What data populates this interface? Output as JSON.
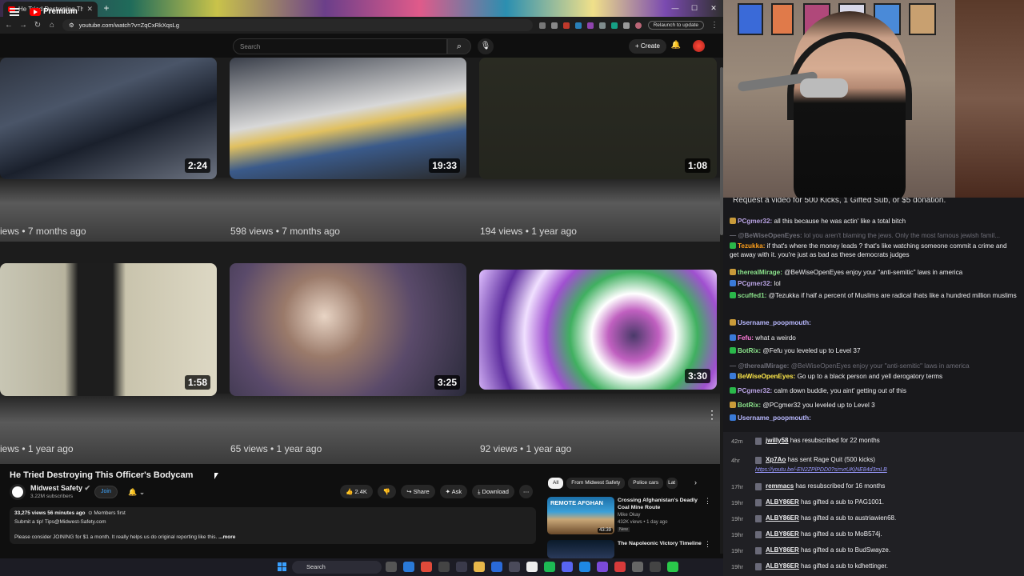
{
  "browser": {
    "tab_title": "He Tried Destroying This Of",
    "url": "youtube.com/watch?v=ZqCxRkXqsLg",
    "relaunch": "Relaunch to update"
  },
  "youtube": {
    "logo": "Premium",
    "search_placeholder": "Search",
    "create": "+ Create"
  },
  "endscreen": {
    "row1": [
      {
        "duration": "2:24",
        "meta": "iews • 7 months ago"
      },
      {
        "duration": "19:33",
        "meta": "598 views • 7 months ago"
      },
      {
        "duration": "1:08",
        "meta": "194 views • 1 year ago"
      }
    ],
    "row2": [
      {
        "duration": "1:58",
        "meta": "iews • 1 year ago"
      },
      {
        "duration": "3:25",
        "meta": "65 views • 1 year ago"
      },
      {
        "duration": "3:30",
        "meta": "92 views • 1 year ago"
      }
    ]
  },
  "video": {
    "title": "He Tried Destroying This Officer's Bodycam",
    "channel": "Midwest Safety",
    "subscribers": "3.22M subscribers",
    "join": "Join",
    "likes": "2.4K",
    "share": "Share",
    "ask": "Ask",
    "download": "Download",
    "desc_line1": "33,275 views  56 minutes ago",
    "desc_members": "Members first",
    "desc_line2": "Submit a tip! Tips@Midwest-Safety.com",
    "desc_line3": "Please consider JOINING for $1 a month. It really helps us do original reporting like this.",
    "desc_more": "...more"
  },
  "sidebar": {
    "chips": [
      "All",
      "From Midwest Safety",
      "Police cars",
      "Lat"
    ],
    "recs": [
      {
        "title": "Crossing Afghanistan's Deadly Coal Mine Route",
        "channel": "Mike Okay",
        "views": "432K views • 1 day ago",
        "badge": "New",
        "duration": "43:39",
        "thumb_text": "REMOTE AFGHAN"
      },
      {
        "title": "The Napoleonic Victory Timeline",
        "channel": "",
        "views": "",
        "badge": "",
        "duration": "",
        "thumb_text": ""
      }
    ]
  },
  "taskbar": {
    "search": "Search"
  },
  "chat": {
    "top": "Request a video for 500 Kicks, 1 Gifted Sub, or $5 donation.",
    "messages": [
      {
        "user": "PCgmer32:",
        "text": "all this because he was actin' like a total bitch",
        "color": "#b9a3e3",
        "faded": false
      },
      {
        "user": "— @BeWiseOpenEyes:",
        "text": "lol you aren't blaming the jews. Only the most famous jewish famil...",
        "color": "#6e6e78",
        "faded": true
      },
      {
        "user": "Tezukka:",
        "text": "if that's where the money leads ? that's like watching someone commit a crime and get away with it. you're just as bad as these democrats judges",
        "color": "#ff9f1a",
        "faded": false
      },
      {
        "user": "therealMirage:",
        "text": "@BeWiseOpenEyes enjoy your \"anti-semitic\" laws in america",
        "color": "#8be28b",
        "faded": false
      },
      {
        "user": "PCgmer32:",
        "text": "lol",
        "color": "#b9a3e3",
        "faded": false
      },
      {
        "user": "scuffed1:",
        "text": "@Tezukka if half a percent of Muslims are radical thats like a hundred million muslims",
        "color": "#8be28b",
        "faded": false
      },
      {
        "user": "Username_poopmouth:",
        "text": "",
        "color": "#b9b9ff",
        "faded": false
      },
      {
        "user": "Fefu:",
        "text": "what a weirdo",
        "color": "#ff7ad9",
        "faded": false
      },
      {
        "user": "BotRix:",
        "text": "@Fefu you leveled up to Level 37",
        "color": "#8be28b",
        "faded": false
      },
      {
        "user": "— @therealMirage:",
        "text": "@BeWiseOpenEyes enjoy your \"anti-semitic\" laws in america",
        "color": "#6e6e78",
        "faded": true
      },
      {
        "user": "BeWiseOpenEyes:",
        "text": "Go up to a black person and yell derogatory terms",
        "color": "#ffe94a",
        "faded": false
      },
      {
        "user": "PCgmer32:",
        "text": "calm down buddie, you aint' getting out of this",
        "color": "#b9a3e3",
        "faded": false
      },
      {
        "user": "BotRix:",
        "text": "@PCgmer32 you leveled up to Level 3",
        "color": "#8be28b",
        "faded": false
      },
      {
        "user": "Username_poopmouth:",
        "text": "",
        "color": "#b9b9ff",
        "faded": false
      }
    ]
  },
  "events": [
    {
      "time": "42m",
      "user": "jwilly58",
      "text": "has resubscribed for 22 months",
      "link": ""
    },
    {
      "time": "4hr",
      "user": "Xp7Ao",
      "text": "has sent Rage Quit (500 kicks)",
      "link": "https://youtu.be/-EN2ZPlPDD0?si=vrUKjNE84d3mLB"
    },
    {
      "time": "17hr",
      "user": "remmacs",
      "text": "has resubscribed for 16 months",
      "link": ""
    },
    {
      "time": "19hr",
      "user": "ALBY86ER",
      "text": "has gifted a sub to PAG1001.",
      "link": ""
    },
    {
      "time": "19hr",
      "user": "ALBY86ER",
      "text": "has gifted a sub to austriawien68.",
      "link": ""
    },
    {
      "time": "19hr",
      "user": "ALBY86ER",
      "text": "has gifted a sub to MoB574j.",
      "link": ""
    },
    {
      "time": "19hr",
      "user": "ALBY86ER",
      "text": "has gifted a sub to BudSwayze.",
      "link": ""
    },
    {
      "time": "19hr",
      "user": "ALBY86ER",
      "text": "has gifted a sub to kdhettinger.",
      "link": ""
    }
  ]
}
